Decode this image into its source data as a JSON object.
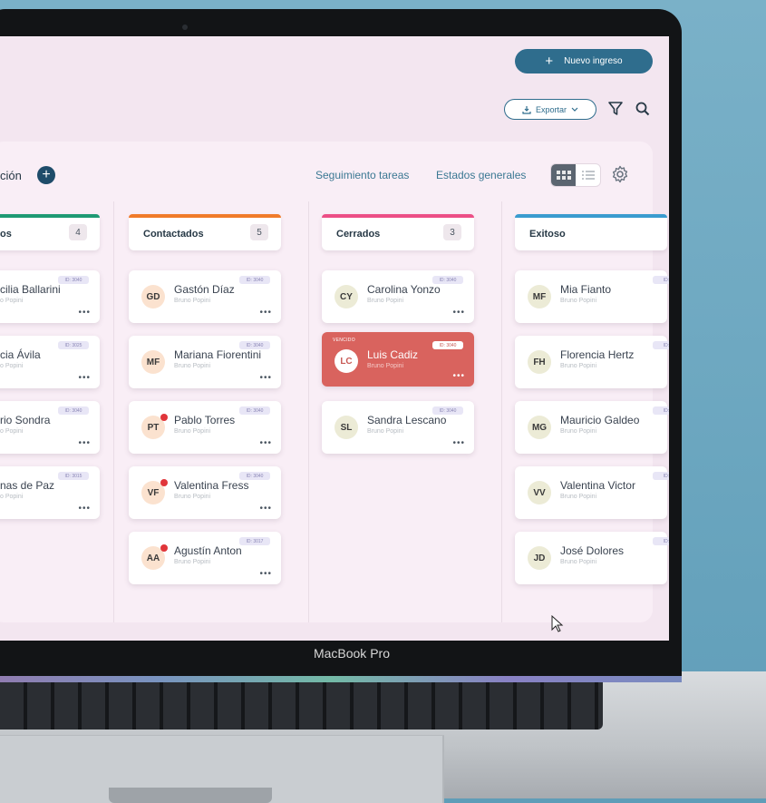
{
  "device": {
    "label": "MacBook Pro"
  },
  "header": {
    "new_button": "Nuevo ingreso",
    "export_button": "Exportar"
  },
  "toolbar": {
    "title": "ción",
    "link_tasks": "Seguimiento tareas",
    "link_states": "Estados generales"
  },
  "columns": [
    {
      "title": "os",
      "count": "4",
      "color": "#1f9a74",
      "cards": [
        {
          "name": "cilia Ballarini",
          "sub": "o Popini",
          "tag": "ID: 3040"
        },
        {
          "name": "cia Ávila",
          "sub": "o Popini",
          "tag": "ID: 3025"
        },
        {
          "name": "rio Sondra",
          "sub": "o Popini",
          "tag": "ID: 3040"
        },
        {
          "name": "nas de Paz",
          "sub": "o Popini",
          "tag": "ID: 3015"
        }
      ]
    },
    {
      "title": "Contactados",
      "count": "5",
      "color": "#f07b2a",
      "cards": [
        {
          "initials": "GD",
          "name": "Gastón Díaz",
          "sub": "Bruno Popini",
          "tag": "ID: 3040",
          "avatar_bg": "#fbe2cf",
          "dot": false
        },
        {
          "initials": "MF",
          "name": "Mariana Fiorentini",
          "sub": "Bruno Popini",
          "tag": "ID: 3040",
          "avatar_bg": "#fbe2cf",
          "dot": false
        },
        {
          "initials": "PT",
          "name": "Pablo Torres",
          "sub": "Bruno Popini",
          "tag": "ID: 3040",
          "avatar_bg": "#fbe2cf",
          "dot": true
        },
        {
          "initials": "VF",
          "name": "Valentina Fress",
          "sub": "Bruno Popini",
          "tag": "ID: 3040",
          "avatar_bg": "#fbe2cf",
          "dot": true
        },
        {
          "initials": "AA",
          "name": "Agustín Anton",
          "sub": "Bruno Popini",
          "tag": "ID: 3017",
          "avatar_bg": "#fbe2cf",
          "dot": true
        }
      ]
    },
    {
      "title": "Cerrados",
      "count": "3",
      "color": "#ec4f86",
      "cards": [
        {
          "initials": "CY",
          "name": "Carolina Yonzo",
          "sub": "Bruno Popini",
          "tag": "ID: 3040",
          "avatar_bg": "#ecebd6",
          "hot": false
        },
        {
          "initials": "LC",
          "name": "Luis Cadiz",
          "sub": "Bruno Popini",
          "tag": "ID: 3040",
          "flag": "VENCIDO",
          "hot": true
        },
        {
          "initials": "SL",
          "name": "Sandra Lescano",
          "sub": "Bruno Popini",
          "tag": "ID: 3040",
          "avatar_bg": "#ecebd6",
          "hot": false
        }
      ]
    },
    {
      "title": "Exitoso",
      "count": "",
      "color": "#3a9ccf",
      "cards": [
        {
          "initials": "MF",
          "name": "Mia Fianto",
          "sub": "Bruno Popini",
          "tag": "ID: 3",
          "avatar_bg": "#ecebd6"
        },
        {
          "initials": "FH",
          "name": "Florencia Hertz",
          "sub": "Bruno Popini",
          "tag": "ID: 3",
          "avatar_bg": "#ecebd6"
        },
        {
          "initials": "MG",
          "name": "Mauricio Galdeo",
          "sub": "Bruno Popini",
          "tag": "ID: 3",
          "avatar_bg": "#ecebd6"
        },
        {
          "initials": "VV",
          "name": "Valentina Victor",
          "sub": "Bruno Popini",
          "tag": "ID: 3",
          "avatar_bg": "#ecebd6"
        },
        {
          "initials": "JD",
          "name": "José Dolores",
          "sub": "Bruno Popini",
          "tag": "ID: 3",
          "avatar_bg": "#ecebd6"
        }
      ]
    }
  ],
  "icons": {
    "new": "plus-icon",
    "export": "download-icon",
    "filter": "filter-icon",
    "search": "search-icon",
    "settings": "gear-icon",
    "more": "more-icon"
  }
}
